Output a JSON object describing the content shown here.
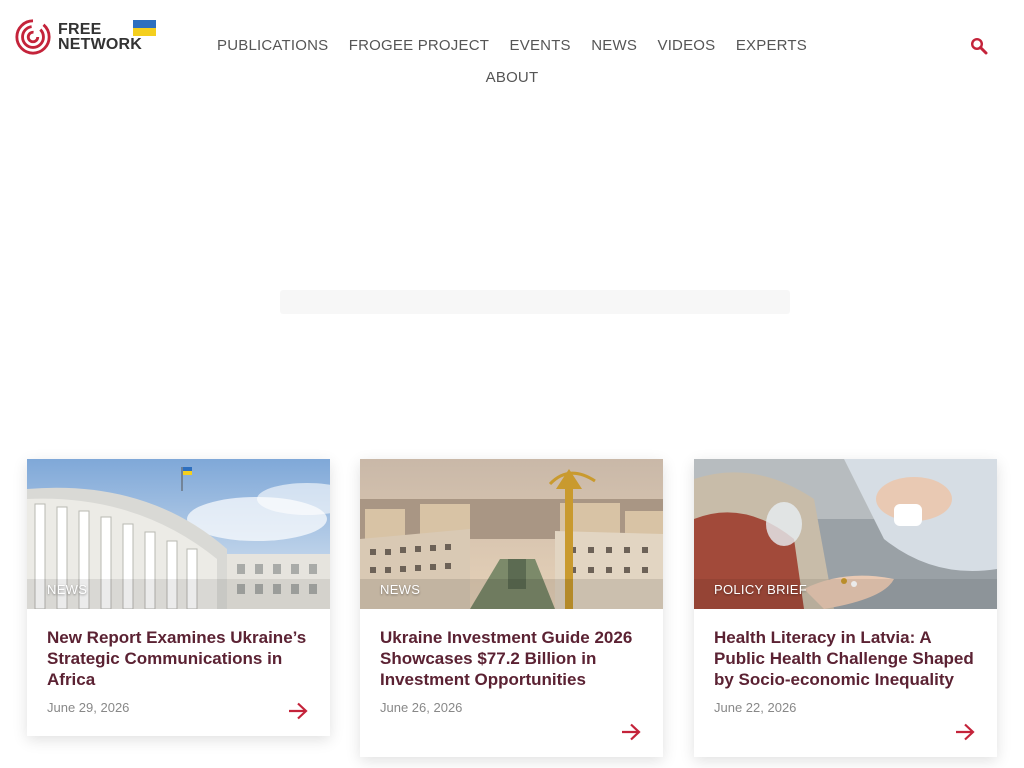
{
  "header": {
    "logo_line1": "FREE",
    "logo_line2": "NETWORK",
    "nav": [
      "PUBLICATIONS",
      "FROGEE PROJECT",
      "EVENTS",
      "NEWS",
      "VIDEOS",
      "EXPERTS",
      "ABOUT"
    ],
    "search_icon": "search-icon",
    "flag": "ukraine-flag",
    "colors": {
      "accent": "#c4233a",
      "nav_text": "#555555",
      "title": "#5b2233"
    }
  },
  "cards": [
    {
      "category": "NEWS",
      "title": "New Report Examines Ukraine’s Strategic Communications in Africa",
      "date": "June 29, 2026"
    },
    {
      "category": "NEWS",
      "title": "Ukraine Investment Guide 2026 Showcases $77.2 Billion in Investment Opportunities",
      "date": "June 26, 2026"
    },
    {
      "category": "POLICY BRIEF",
      "title": "Health Literacy in Latvia: A Public Health Challenge Shaped by Socio-economic Inequality",
      "date": "June 22, 2026"
    }
  ]
}
